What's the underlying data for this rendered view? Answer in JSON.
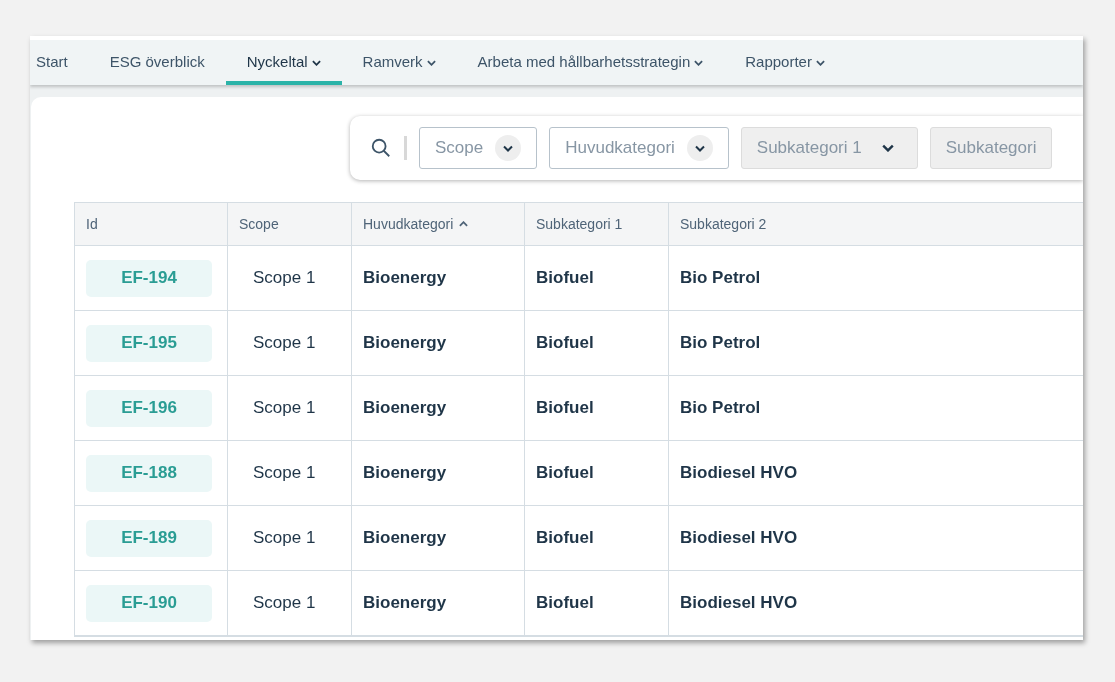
{
  "nav": {
    "tabs": [
      {
        "label": "Start",
        "selected": false,
        "has_menu": false
      },
      {
        "label": "ESG överblick",
        "selected": false,
        "has_menu": false
      },
      {
        "label": "Nyckeltal",
        "selected": true,
        "has_menu": true
      },
      {
        "label": "Ramverk",
        "selected": false,
        "has_menu": true
      },
      {
        "label": "Arbeta med hållbarhetsstrategin",
        "selected": false,
        "has_menu": true
      },
      {
        "label": "Rapporter",
        "selected": false,
        "has_menu": true
      }
    ]
  },
  "filters": [
    {
      "placeholder": "Scope",
      "disabled": false
    },
    {
      "placeholder": "Huvudkategori",
      "disabled": false
    },
    {
      "placeholder": "Subkategori 1",
      "disabled": true
    },
    {
      "placeholder": "Subkategori",
      "disabled": true
    }
  ],
  "table": {
    "columns": [
      {
        "label": "Id",
        "sorted": false
      },
      {
        "label": "Scope",
        "sorted": false
      },
      {
        "label": "Huvudkategori",
        "sorted": true
      },
      {
        "label": "Subkategori 1",
        "sorted": false
      },
      {
        "label": "Subkategori 2",
        "sorted": false
      }
    ],
    "rows": [
      [
        "EF-194",
        "Scope 1",
        "Bioenergy",
        "Biofuel",
        "Bio Petrol"
      ],
      [
        "EF-195",
        "Scope 1",
        "Bioenergy",
        "Biofuel",
        "Bio Petrol"
      ],
      [
        "EF-196",
        "Scope 1",
        "Bioenergy",
        "Biofuel",
        "Bio Petrol"
      ],
      [
        "EF-188",
        "Scope 1",
        "Bioenergy",
        "Biofuel",
        "Biodiesel HVO"
      ],
      [
        "EF-189",
        "Scope 1",
        "Bioenergy",
        "Biofuel",
        "Biodiesel HVO"
      ],
      [
        "EF-190",
        "Scope 1",
        "Bioenergy",
        "Biofuel",
        "Biodiesel HVO"
      ]
    ]
  }
}
